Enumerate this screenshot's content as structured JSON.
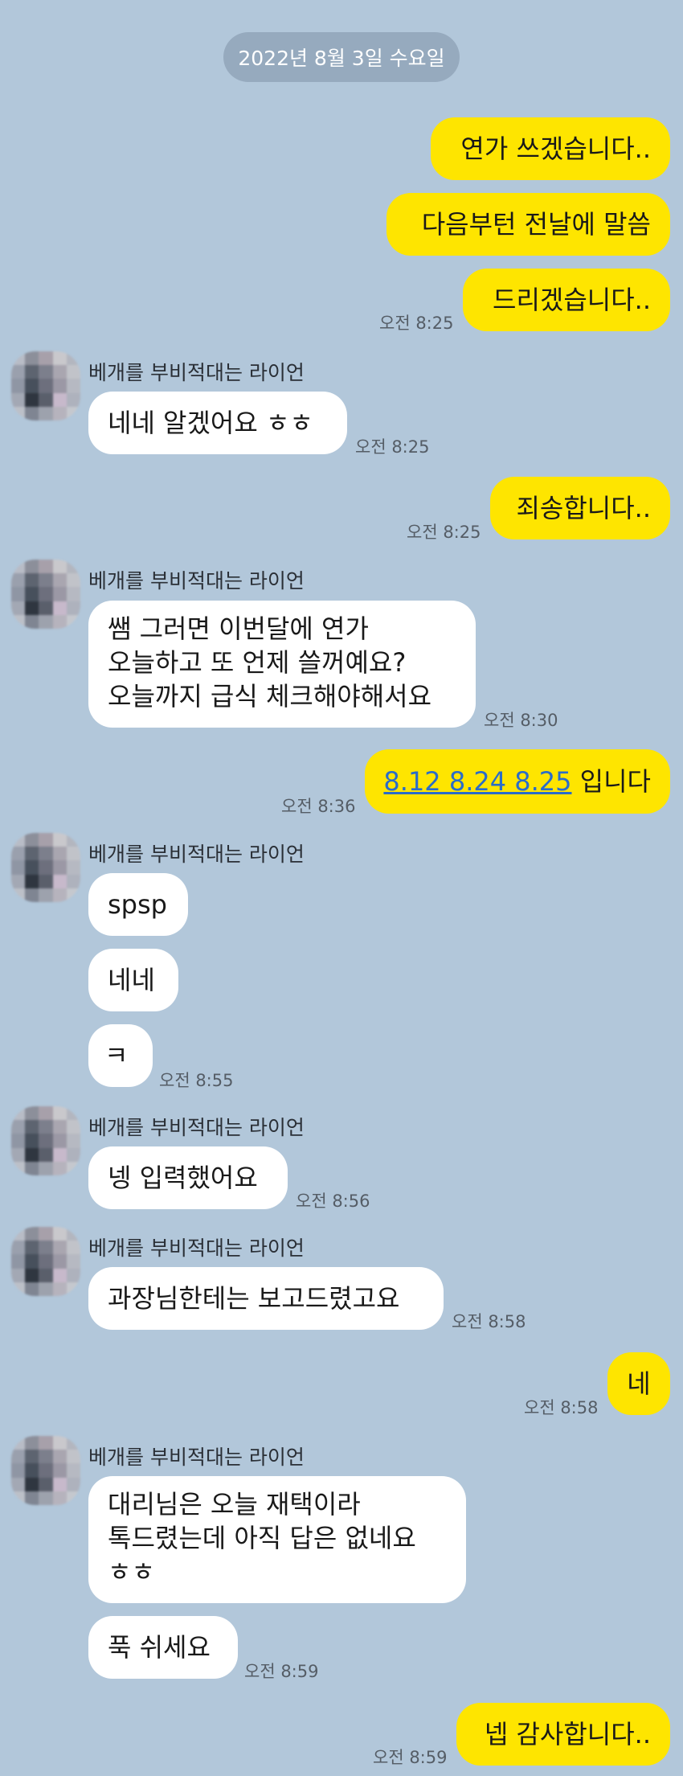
{
  "date_divider": "2022년 8월 3일 수요일",
  "sender_name": "베개를 부비적대는 라이언",
  "messages": {
    "m1": "연가 쓰겠습니다..",
    "m2": "다음부턴 전날에 말씀",
    "m3": "드리겠습니다..",
    "m3_time": "오전 8:25",
    "m4": "네네 알겠어요 ㅎㅎ",
    "m4_time": "오전 8:25",
    "m5": "죄송합니다..",
    "m5_time": "오전 8:25",
    "m6_line1": "쌤 그러면 이번달에 연가",
    "m6_line2": "오늘하고 또 언제 쓸꺼예요?",
    "m6_line3": "오늘까지 급식 체크해야해서요",
    "m6_time": "오전 8:30",
    "m7_link": "8.12 8.24 8.25",
    "m7_suffix": " 입니다",
    "m7_time": "오전 8:36",
    "m8": "spsp",
    "m9": "네네",
    "m10": "ㅋ",
    "m10_time": "오전 8:55",
    "m11": "넹 입력했어요",
    "m11_time": "오전 8:56",
    "m12": "과장님한테는 보고드렸고요",
    "m12_time": "오전 8:58",
    "m13": "네",
    "m13_time": "오전 8:58",
    "m14_line1": "대리님은 오늘 재택이라",
    "m14_line2": "톡드렸는데 아직 답은 없네요",
    "m14_line3": "ㅎㅎ",
    "m15": "푹 쉬세요",
    "m15_time": "오전 8:59",
    "m16": "넵 감사합니다..",
    "m16_time": "오전 8:59"
  },
  "colors": {
    "background": "#b2c7da",
    "outgoing_bubble": "#fee500",
    "incoming_bubble": "#ffffff",
    "link": "#2a6cc9"
  },
  "icons": {
    "avatar": "pixelated-profile-avatar"
  }
}
